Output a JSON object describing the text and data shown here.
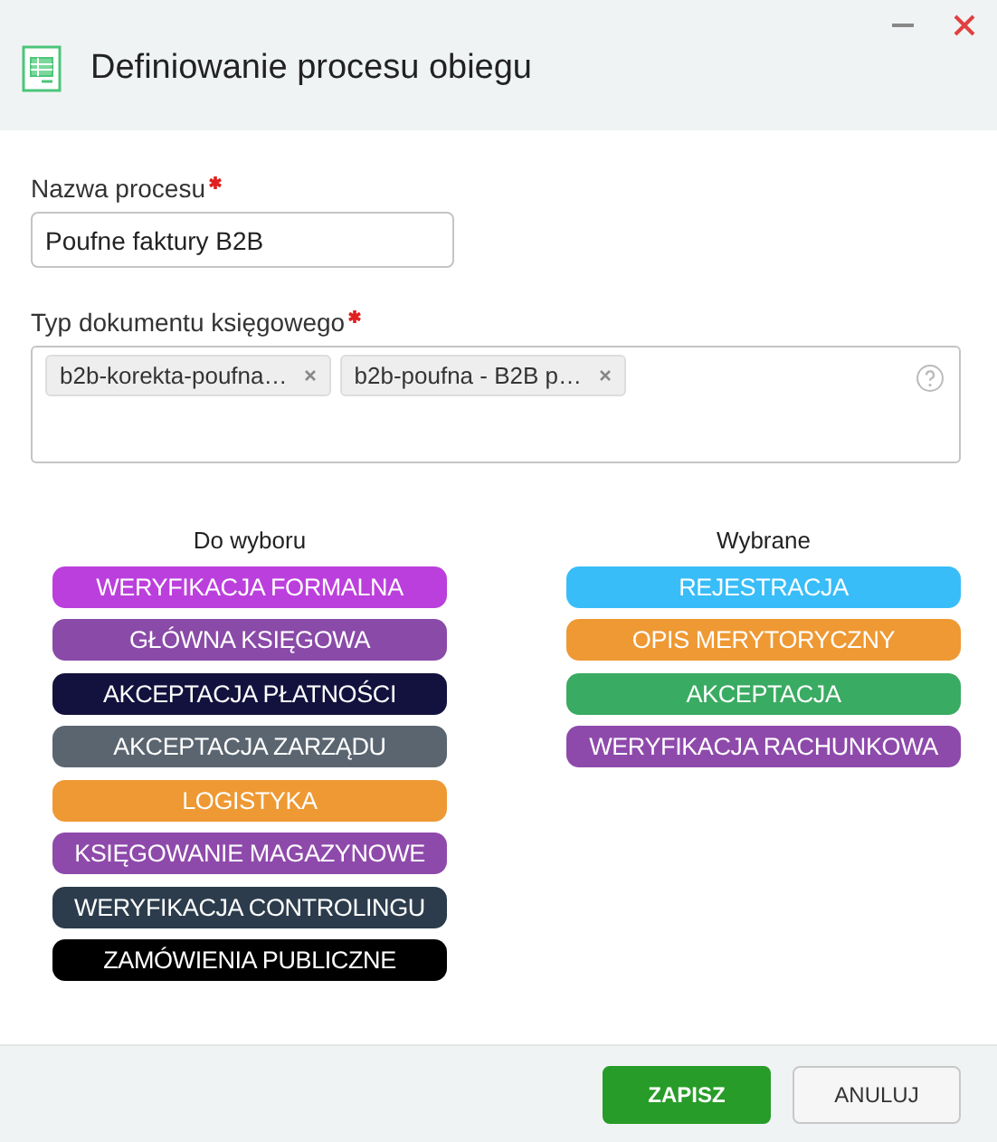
{
  "window": {
    "title": "Definiowanie procesu obiegu"
  },
  "process_name": {
    "label": "Nazwa procesu",
    "required": true,
    "value": "Poufne faktury B2B"
  },
  "document_type": {
    "label": "Typ dokumentu księgowego",
    "required": true,
    "tags": [
      {
        "label": "b2b-korekta-poufna…"
      },
      {
        "label": "b2b-poufna - B2B p…"
      }
    ]
  },
  "available": {
    "title": "Do wyboru",
    "items": [
      {
        "label": "WERYFIKACJA FORMALNA",
        "color": "#bb3fdc"
      },
      {
        "label": "GŁÓWNA KSIĘGOWA",
        "color": "#8a4aa8"
      },
      {
        "label": "AKCEPTACJA PŁATNOŚCI",
        "color": "#13123e"
      },
      {
        "label": "AKCEPTACJA ZARZĄDU",
        "color": "#5a6570"
      },
      {
        "label": "LOGISTYKA",
        "color": "#ee9933"
      },
      {
        "label": "KSIĘGOWANIE MAGAZYNOWE",
        "color": "#8e4aab"
      },
      {
        "label": "WERYFIKACJA CONTROLINGU",
        "color": "#2c3c4c"
      },
      {
        "label": "ZAMÓWIENIA PUBLICZNE",
        "color": "#000000"
      }
    ]
  },
  "selected": {
    "title": "Wybrane",
    "items": [
      {
        "label": "REJESTRACJA",
        "color": "#38bdf8"
      },
      {
        "label": "OPIS MERYTORYCZNY",
        "color": "#ee9933"
      },
      {
        "label": "AKCEPTACJA",
        "color": "#3aab62"
      },
      {
        "label": "WERYFIKACJA RACHUNKOWA",
        "color": "#8e4aab"
      }
    ]
  },
  "buttons": [
    {
      "label": "ZAPISZ",
      "kind": "primary"
    },
    {
      "label": "ANULUJ",
      "kind": "secondary"
    }
  ]
}
